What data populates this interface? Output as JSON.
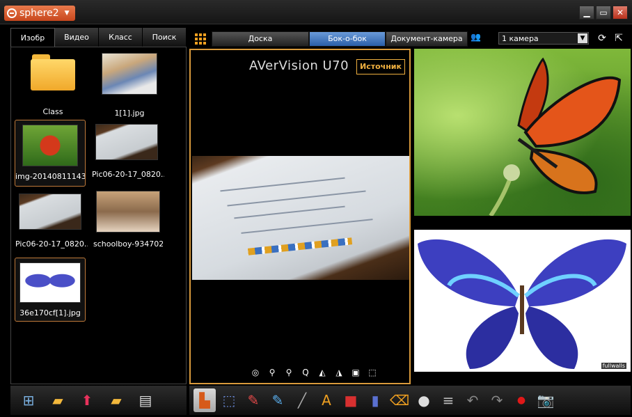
{
  "app": {
    "name": "sphere2",
    "window_controls": [
      "minimize",
      "maximize",
      "close"
    ]
  },
  "left_tabs": [
    {
      "label": "Изобр",
      "active": true
    },
    {
      "label": "Видео",
      "active": false
    },
    {
      "label": "Класс",
      "active": false
    },
    {
      "label": "Поиск",
      "active": false
    }
  ],
  "files": [
    {
      "caption": "Class",
      "kind": "folder",
      "selected": false
    },
    {
      "caption": "1[1].jpg",
      "kind": "photo-kid",
      "selected": false
    },
    {
      "caption": "img-20140811143...",
      "kind": "photo-butterfly",
      "selected": true
    },
    {
      "caption": "Pic06-20-17_0820...",
      "kind": "photo-doc",
      "selected": false
    },
    {
      "caption": "Pic06-20-17_0820...",
      "kind": "photo-doc",
      "selected": false
    },
    {
      "caption": "schoolboy-934702...",
      "kind": "photo-class",
      "selected": false
    },
    {
      "caption": "36e170cf[1].jpg",
      "kind": "photo-blue-butterfly",
      "selected": true
    }
  ],
  "modes": [
    {
      "label": "Доска",
      "active": false
    },
    {
      "label": "Бок-о-бок",
      "active": true
    },
    {
      "label": "Документ-камера",
      "active": false
    }
  ],
  "camera_select": {
    "value": "1 камера"
  },
  "camera_view": {
    "title": "AVerVision U70",
    "source_button": "Источник"
  },
  "watermark": "fullwalls",
  "icons": {
    "left_bar": [
      "layout-icon",
      "open-folder-icon",
      "upload-icon",
      "new-folder-icon",
      "notes-icon"
    ],
    "right_bar": [
      "select-frame-icon",
      "area-select-icon",
      "pen-icon",
      "highlighter-icon",
      "line-icon",
      "text-icon",
      "shape-icon",
      "marker-icon",
      "eraser-icon",
      "palette-icon",
      "line-width-icon",
      "undo-icon",
      "redo-icon",
      "record-icon",
      "camera-icon"
    ],
    "cam_controls": [
      "focus-icon",
      "zoom-in-icon",
      "zoom-out-icon",
      "auto-icon",
      "rotate-left-icon",
      "rotate-right-icon",
      "freeze-icon",
      "capture-icon"
    ]
  },
  "colors": {
    "accent_orange": "#d99a3c",
    "active_tab_blue": "#2a5ea8",
    "brand_orange": "#c8461c"
  }
}
